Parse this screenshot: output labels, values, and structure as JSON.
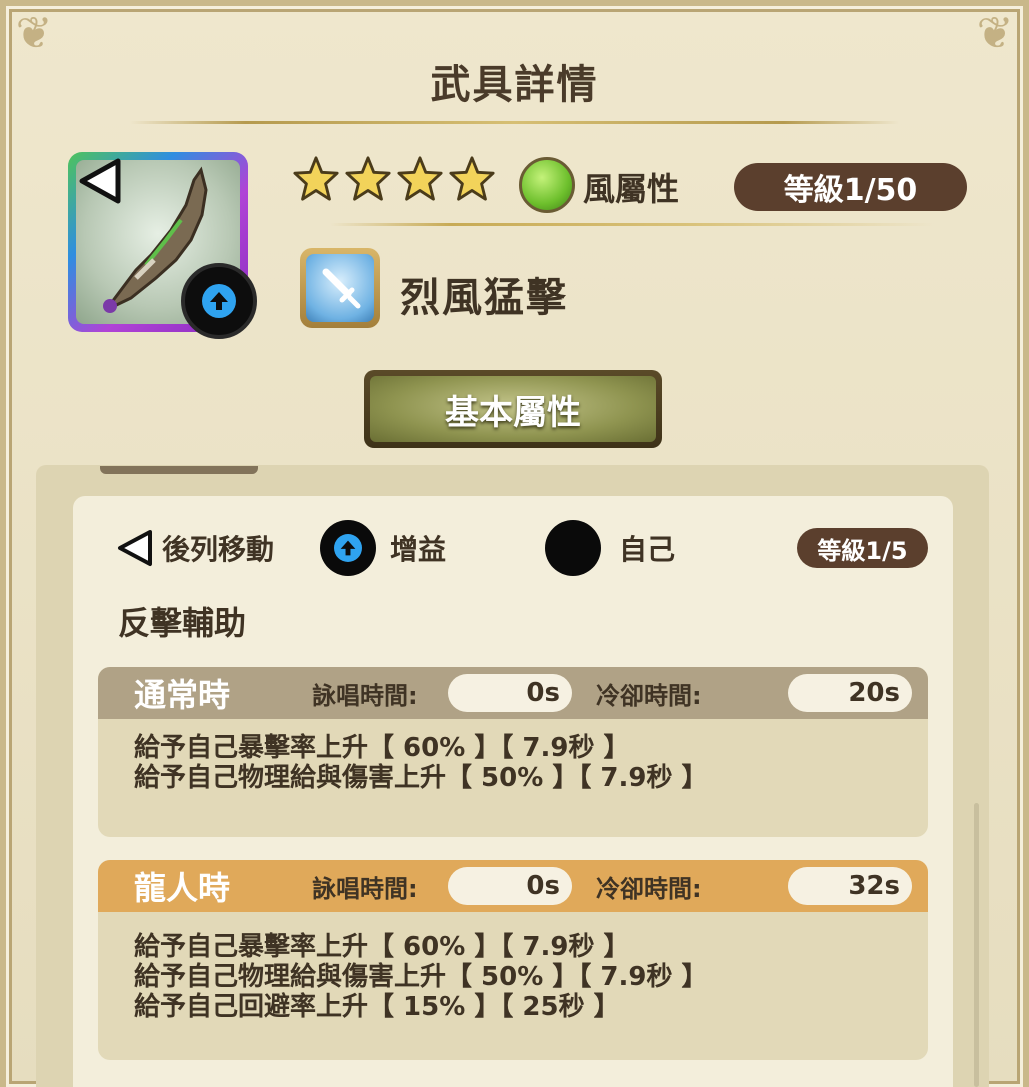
{
  "title": "武具詳情",
  "weapon": {
    "stars": 4,
    "attribute_label": "風屬性",
    "level": "等級1/50",
    "skill_name": "烈風猛擊",
    "basic_button": "基本屬性"
  },
  "skill": {
    "tags": [
      {
        "label": "後列移動",
        "icon": "back-arrow-icon"
      },
      {
        "label": "增益",
        "icon": "buff-up-icon"
      },
      {
        "label": "自己",
        "icon": "self-circle-icon"
      }
    ],
    "level": "等級1/5",
    "effect_name": "反擊輔助",
    "modes": [
      {
        "name": "通常時",
        "cast_label": "詠唱時間:",
        "cast_value": "0s",
        "cooldown_label": "冷卻時間:",
        "cooldown_value": "20s",
        "header_color": "#b0a286",
        "lines": [
          "給予自己暴擊率上升【 60% 】【 7.9秒 】",
          "給予自己物理給與傷害上升【 50% 】【 7.9秒 】"
        ]
      },
      {
        "name": "龍人時",
        "cast_label": "詠唱時間:",
        "cast_value": "0s",
        "cooldown_label": "冷卻時間:",
        "cooldown_value": "32s",
        "header_color": "#e0a95a",
        "lines": [
          "給予自己暴擊率上升【 60% 】【 7.9秒 】",
          "給予自己物理給與傷害上升【 50% 】【 7.9秒 】",
          "給予自己回避率上升【 15% 】【 25秒 】"
        ]
      }
    ]
  }
}
